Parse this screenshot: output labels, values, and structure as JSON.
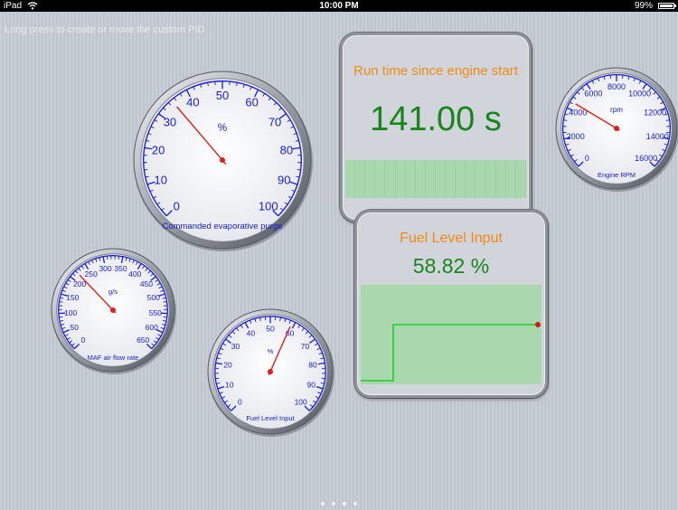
{
  "status_bar": {
    "device": "iPad",
    "time": "10:00 PM",
    "battery": "99%",
    "battery_level": 0.99
  },
  "hint": "Long press to create or move the custom PID",
  "gauges": [
    {
      "id": "evap",
      "label": "Commanded evaporative purge",
      "unit": "%",
      "min": 0,
      "max": 100,
      "value": 35,
      "ticks": [
        "0",
        "10",
        "20",
        "30",
        "40",
        "50",
        "60",
        "70",
        "80",
        "90",
        "100"
      ]
    },
    {
      "id": "rpm",
      "label": "Engine RPM",
      "unit": "rpm",
      "min": 0,
      "max": 16000,
      "value": 4500,
      "ticks": [
        "0",
        "2000",
        "4000",
        "6000",
        "8000",
        "10000",
        "12000",
        "14000",
        "16000"
      ]
    },
    {
      "id": "maf",
      "label": "MAF air flow rate",
      "unit": "g/s",
      "min": 0,
      "max": 650,
      "value": 220,
      "ticks": [
        "0",
        "50",
        "100",
        "150",
        "200",
        "250",
        "300",
        "350",
        "400",
        "450",
        "500",
        "550",
        "600",
        "650"
      ]
    },
    {
      "id": "fuel",
      "label": "Fuel Level Input",
      "unit": "%",
      "min": 0,
      "max": 100,
      "value": 58.82,
      "ticks": [
        "0",
        "10",
        "20",
        "30",
        "40",
        "50",
        "60",
        "70",
        "80",
        "90",
        "100"
      ]
    }
  ],
  "panels": {
    "runtime": {
      "title": "Run time since engine start",
      "value": "141.00 s"
    },
    "fuel": {
      "title": "Fuel Level Input",
      "value": "58.82 %"
    }
  },
  "page_indicator": {
    "count": 4,
    "current": 3
  }
}
